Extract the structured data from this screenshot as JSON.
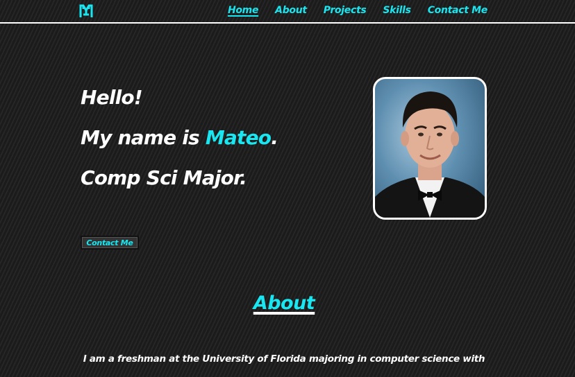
{
  "nav": {
    "logo_text": "M",
    "links": [
      {
        "label": "Home",
        "active": true
      },
      {
        "label": "About"
      },
      {
        "label": "Projects"
      },
      {
        "label": "Skills"
      },
      {
        "label": "Contact Me"
      }
    ]
  },
  "hero": {
    "greeting": "Hello!",
    "intro_prefix": "My name is ",
    "name": "Mateo",
    "intro_suffix": ".",
    "major": "Comp Sci Major.",
    "contact_button": "Contact Me"
  },
  "about": {
    "heading": "About",
    "text": "I am a freshman at the University of Florida majoring in computer science with"
  },
  "colors": {
    "accent": "#19e6f0",
    "background": "#1f1f1f",
    "text": "#ffffff"
  }
}
